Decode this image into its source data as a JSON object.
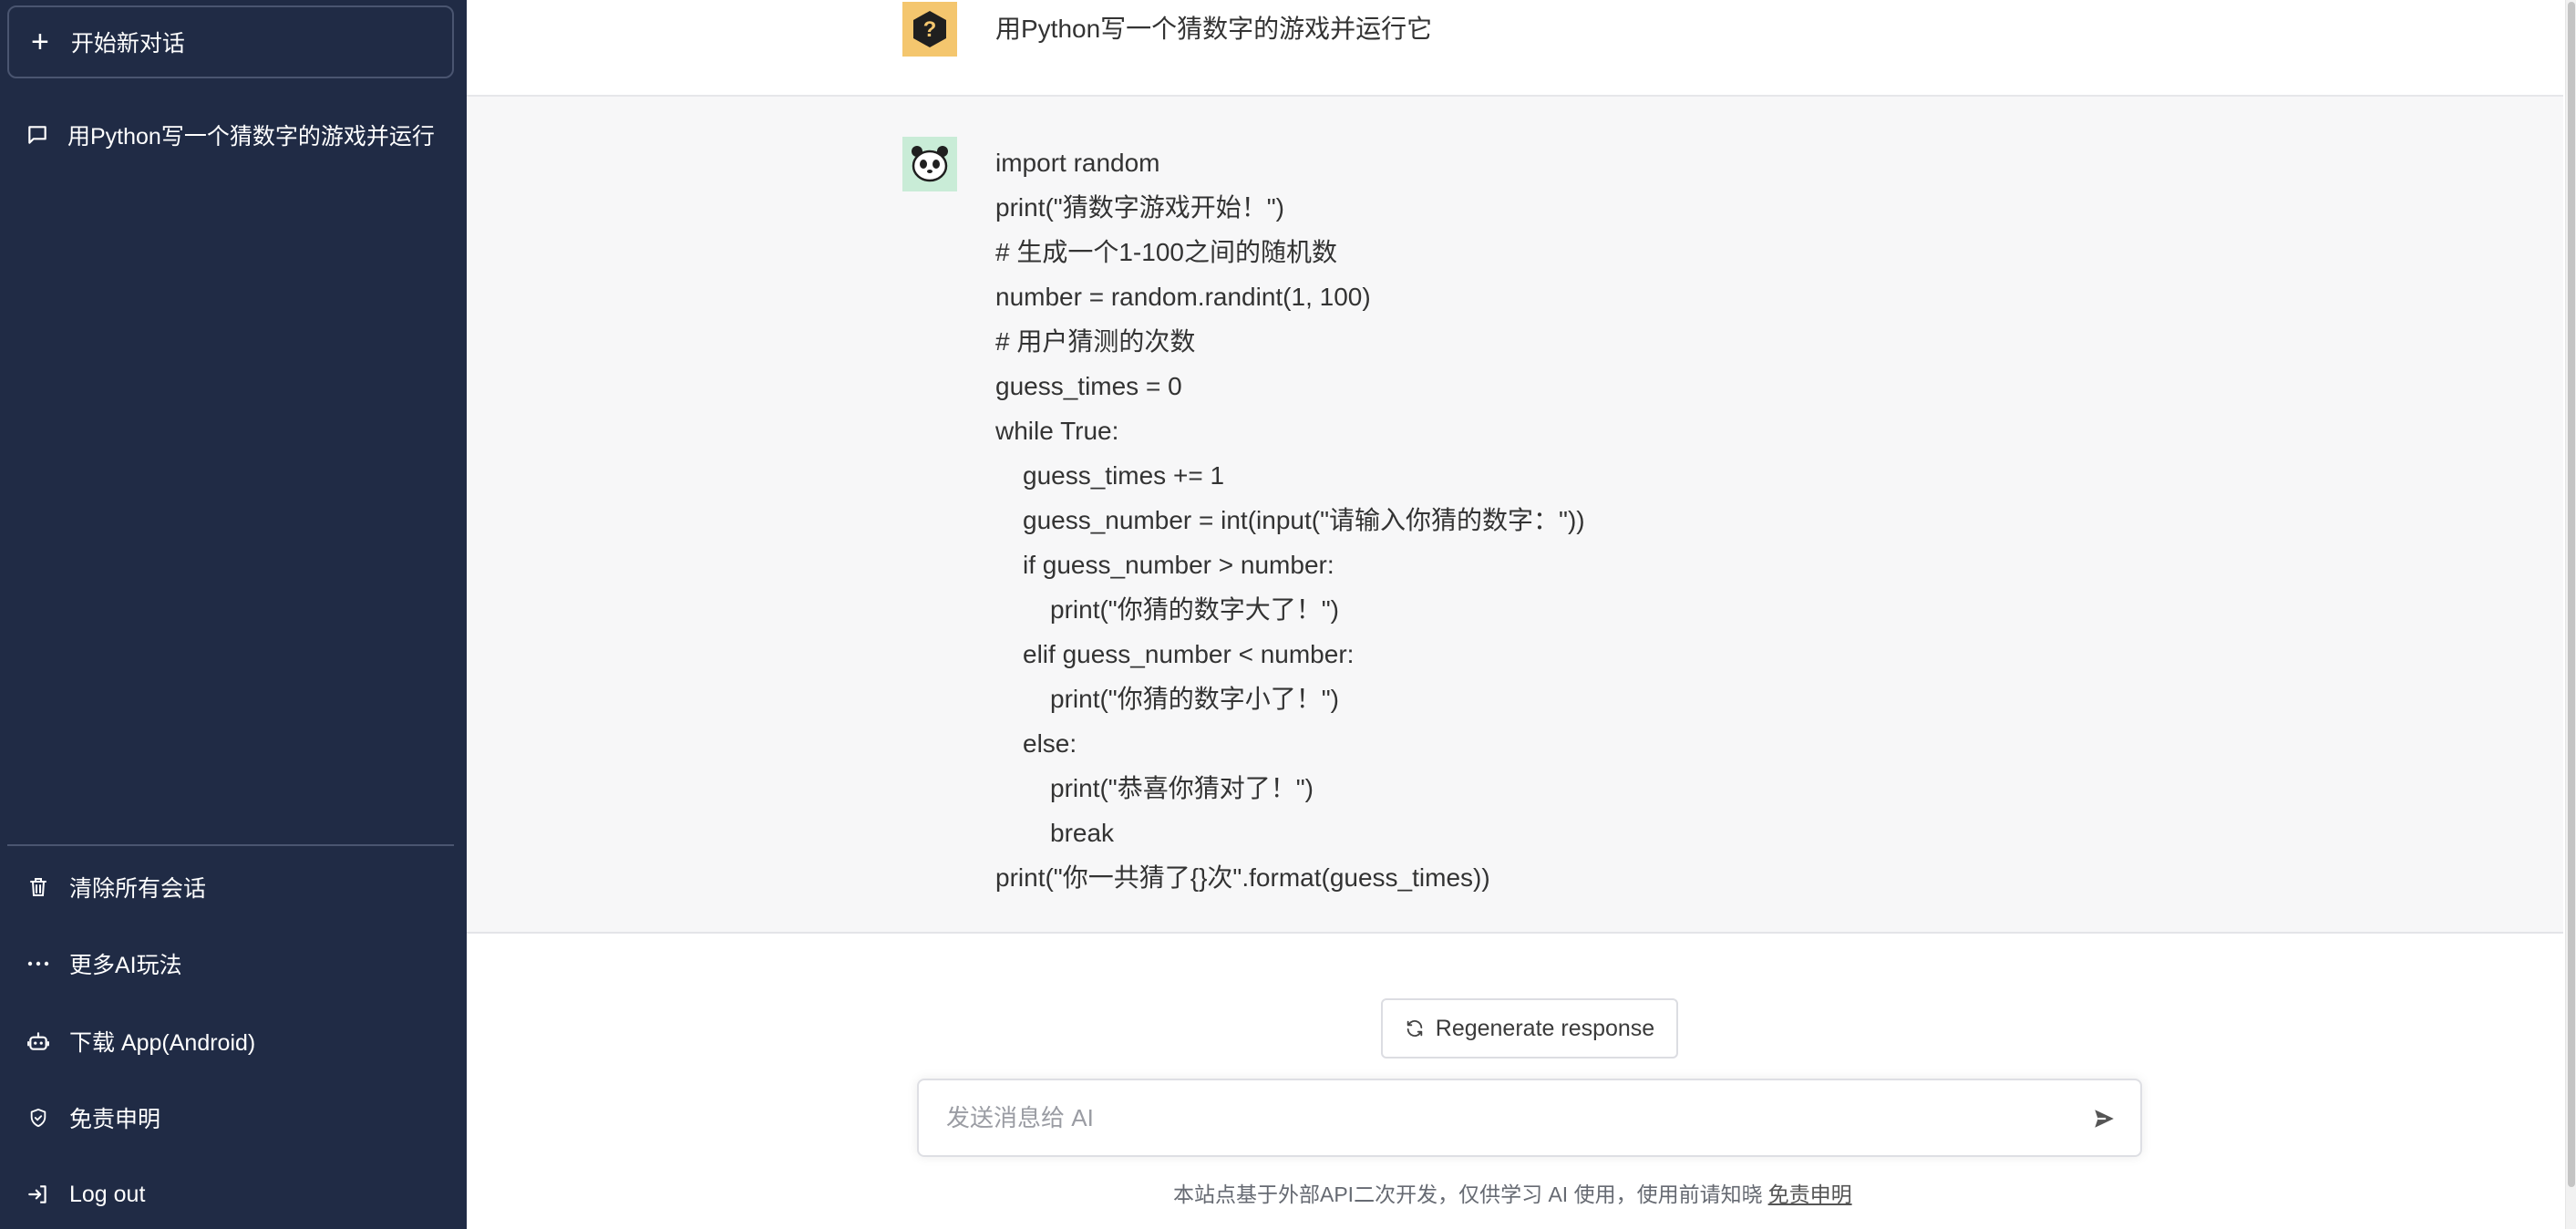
{
  "sidebar": {
    "new_chat_label": "开始新对话",
    "history": [
      {
        "label": "用Python写一个猜数字的游戏并运行"
      }
    ],
    "bottom_links": [
      {
        "icon": "trash-icon",
        "label": "清除所有会话"
      },
      {
        "icon": "more-dots-icon",
        "label": "更多AI玩法"
      },
      {
        "icon": "robot-icon",
        "label": "下载 App(Android)"
      },
      {
        "icon": "shield-icon",
        "label": "免责申明"
      },
      {
        "icon": "logout-icon",
        "label": "Log out"
      }
    ]
  },
  "conversation": {
    "user_message": "用Python写一个猜数字的游戏并运行它",
    "ai_code_lines": [
      {
        "indent": 0,
        "text": "import random"
      },
      {
        "indent": 0,
        "text": "print(\"猜数字游戏开始！\")"
      },
      {
        "indent": 0,
        "text": "# 生成一个1-100之间的随机数"
      },
      {
        "indent": 0,
        "text": "number = random.randint(1, 100)"
      },
      {
        "indent": 0,
        "text": "# 用户猜测的次数"
      },
      {
        "indent": 0,
        "text": "guess_times = 0"
      },
      {
        "indent": 0,
        "text": "while True:"
      },
      {
        "indent": 1,
        "text": "guess_times += 1"
      },
      {
        "indent": 1,
        "text": "guess_number = int(input(\"请输入你猜的数字：\"))"
      },
      {
        "indent": 1,
        "text": "if guess_number > number:"
      },
      {
        "indent": 2,
        "text": "print(\"你猜的数字大了！\")"
      },
      {
        "indent": 1,
        "text": "elif guess_number < number:"
      },
      {
        "indent": 2,
        "text": "print(\"你猜的数字小了！\")"
      },
      {
        "indent": 1,
        "text": "else:"
      },
      {
        "indent": 2,
        "text": "print(\"恭喜你猜对了！\")"
      },
      {
        "indent": 2,
        "text": "break"
      },
      {
        "indent": 0,
        "text": "print(\"你一共猜了{}次\".format(guess_times))"
      }
    ]
  },
  "composer": {
    "regenerate_label": "Regenerate response",
    "input_placeholder": "发送消息给 AI",
    "input_value": ""
  },
  "footer": {
    "note": "本站点基于外部API二次开发，仅供学习 AI 使用，使用前请知晓",
    "link": "免责申明"
  },
  "colors": {
    "sidebar_bg": "#202b45",
    "user_avatar_bg": "#f4c66e",
    "ai_avatar_bg": "#c9ecd7",
    "ai_row_bg": "#f7f7f8"
  }
}
